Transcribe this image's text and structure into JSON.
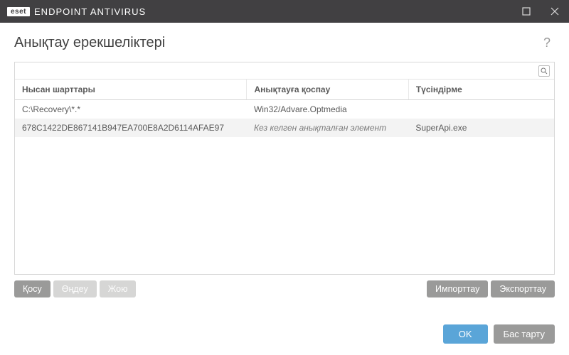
{
  "titlebar": {
    "brand": "eset",
    "appname": "ENDPOINT ANTIVIRUS"
  },
  "header": {
    "title": "Анықтау ерекшеліктері",
    "help": "?"
  },
  "table": {
    "columns": [
      "Нысан шарттары",
      "Анықтауға қоспау",
      "Түсіндірме"
    ],
    "rows": [
      {
        "criteria": "C:\\Recovery\\*.*",
        "exclude": "Win32/Advare.Optmedia",
        "comment": "",
        "selected": false,
        "italic": false
      },
      {
        "criteria": "678C1422DE867141B947EA700E8A2D6114AFAE97",
        "exclude": "Кез келген анықталған элемент",
        "comment": "SuperApi.exe",
        "selected": true,
        "italic": true
      }
    ]
  },
  "buttons": {
    "add": "Қосу",
    "edit": "Өңдеу",
    "delete": "Жою",
    "import": "Импорттау",
    "export": "Экспорттау",
    "ok": "OK",
    "cancel": "Бас тарту"
  }
}
